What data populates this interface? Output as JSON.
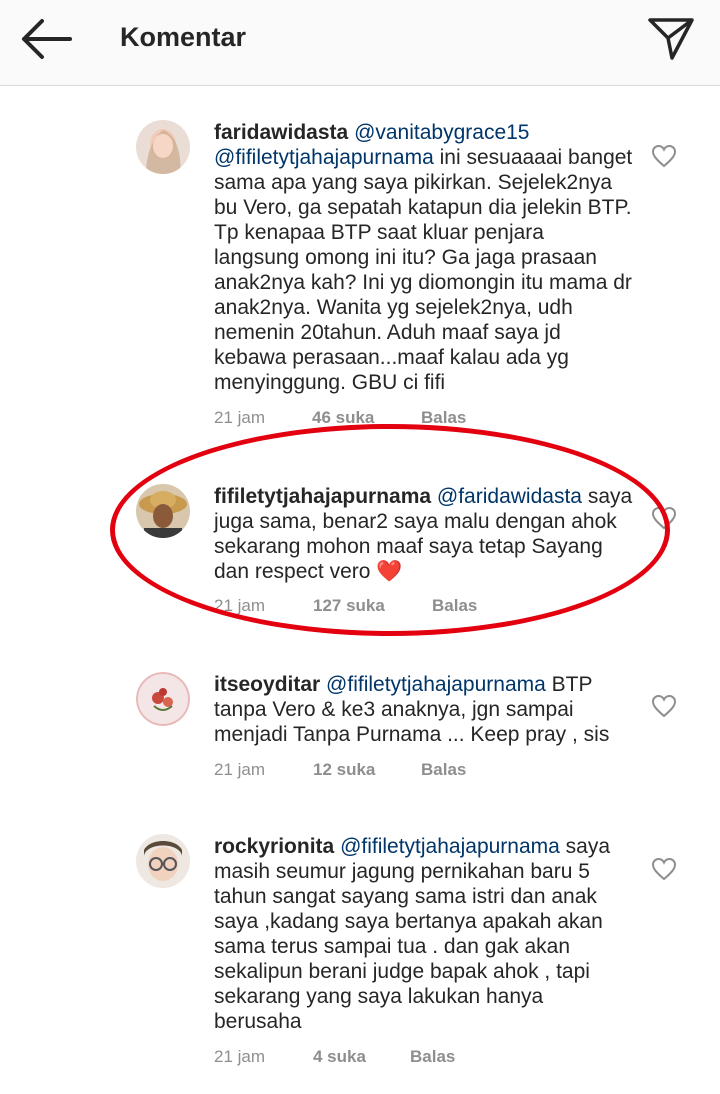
{
  "header": {
    "title": "Komentar",
    "back_icon": "arrow-left-icon",
    "send_icon": "paper-plane-icon"
  },
  "comments": [
    {
      "username": "faridawidasta",
      "mention": "@vanitabygrace15",
      "mention2": "@fifiletytjahajapurnama",
      "text": "ini sesuaaaai banget sama apa yang saya pikirkan. Sejelek2nya bu Vero, ga sepatah katapun dia jelekin BTP. Tp kenapaa BTP saat kluar penjara langsung omong ini itu? Ga jaga prasaan anak2nya kah? Ini yg diomongin itu mama dr anak2nya. Wanita yg sejelek2nya, udh nemenin 20tahun. Aduh maaf saya jd kebawa perasaan...maaf kalau ada yg menyinggung. GBU ci fifi",
      "time": "21 jam",
      "likes": "46 suka",
      "reply": "Balas"
    },
    {
      "username": "fifiletytjahajapurnama",
      "mention": "@faridawidasta",
      "text": "saya juga sama, benar2 saya malu dengan ahok sekarang mohon maaf saya tetap Sayang dan respect vero",
      "emoji": "❤️",
      "time": "21 jam",
      "likes": "127 suka",
      "reply": "Balas"
    },
    {
      "username": "itseoyditar",
      "mention": "@fifiletytjahajapurnama",
      "text": "BTP tanpa Vero & ke3 anaknya, jgn sampai menjadi Tanpa Purnama ... Keep pray , sis",
      "time": "21 jam",
      "likes": "12 suka",
      "reply": "Balas"
    },
    {
      "username": "rockyrionita",
      "mention": "@fifiletytjahajapurnama",
      "text": "saya masih seumur jagung pernikahan baru 5 tahun sangat sayang sama istri dan anak saya ,kadang saya bertanya apakah akan sama terus sampai tua . dan gak akan sekalipun  berani judge bapak ahok , tapi sekarang yang saya lakukan hanya berusaha",
      "time": "21 jam",
      "likes": "4 suka",
      "reply": "Balas"
    }
  ],
  "colors": {
    "mention": "#003569",
    "meta": "#8e8e8e",
    "highlight": "#e3000f",
    "heart_emoji": "#e0142b"
  },
  "icons": {
    "like": "heart-outline-icon"
  }
}
